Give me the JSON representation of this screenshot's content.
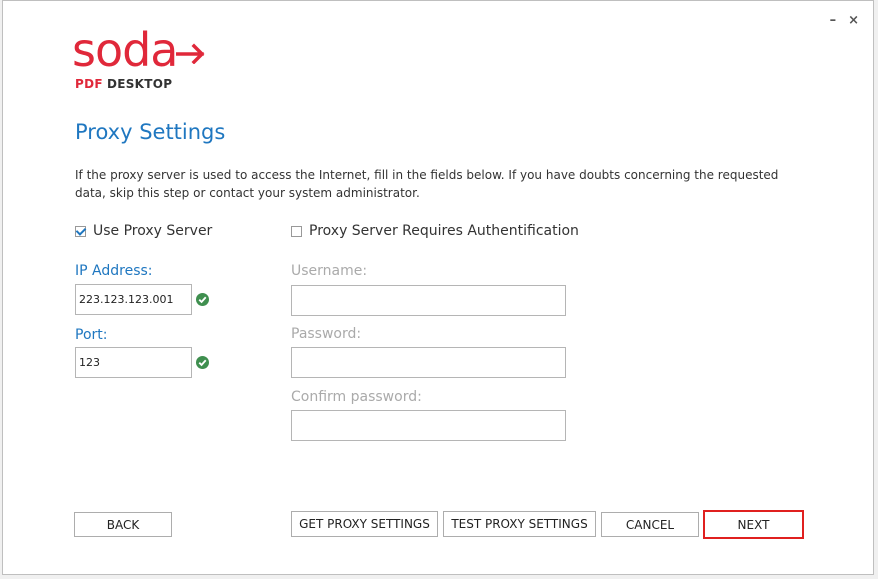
{
  "window": {
    "minimize_glyph": "–",
    "close_glyph": "×"
  },
  "logo": {
    "main": "soda",
    "pdf": "PDF",
    "desktop": "DESKTOP",
    "color": "#e0283a"
  },
  "page": {
    "title": "Proxy Settings",
    "description": "If the proxy server is used to access the Internet, fill in the fields below. If you have doubts concerning the requested data, skip this step or contact your system administrator."
  },
  "options": {
    "use_proxy_label": "Use Proxy Server",
    "use_proxy_checked": true,
    "auth_label": "Proxy Server Requires Authentification",
    "auth_checked": false
  },
  "fields": {
    "ip_label": "IP Address:",
    "ip_value": "223.123.123.001",
    "port_label": "Port:",
    "port_value": "123",
    "username_label": "Username:",
    "username_value": "",
    "password_label": "Password:",
    "password_value": "",
    "confirm_label": "Confirm password:",
    "confirm_value": ""
  },
  "buttons": {
    "back": "BACK",
    "get_proxy": "GET PROXY SETTINGS",
    "test_proxy": "TEST PROXY SETTINGS",
    "cancel": "CANCEL",
    "next": "NEXT"
  },
  "colors": {
    "accent": "#1f77c0",
    "valid": "#3f8f4f",
    "next_border": "#e0201f"
  }
}
